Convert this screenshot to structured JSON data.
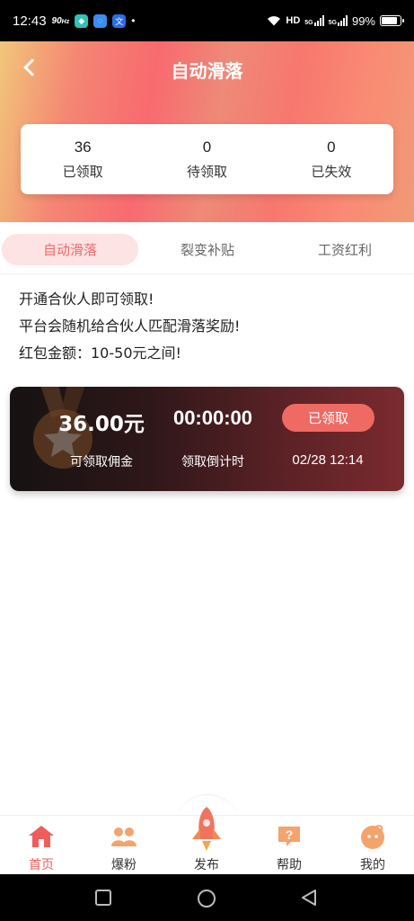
{
  "status_bar": {
    "time": "12:43",
    "refresh": "90",
    "refresh_unit": "Hz",
    "app_icons": [
      {
        "name": "app-icon-1",
        "color": "#2ec4b6"
      },
      {
        "name": "chat-icon",
        "color": "#3b8df0"
      },
      {
        "name": "translate-icon",
        "color": "#2b6de8"
      }
    ],
    "network": "HD",
    "sim1": "5G",
    "sim2": "5G",
    "battery": "99%"
  },
  "header": {
    "title": "自动滑落",
    "back_icon": "chevron-left-icon"
  },
  "stats": [
    {
      "value": "36",
      "label": "已领取"
    },
    {
      "value": "0",
      "label": "待领取"
    },
    {
      "value": "0",
      "label": "已失效"
    }
  ],
  "tabs": [
    {
      "label": "自动滑落",
      "active": true
    },
    {
      "label": "裂变补贴",
      "active": false
    },
    {
      "label": "工资红利",
      "active": false
    }
  ],
  "intro": {
    "line1": "开通合伙人即可领取!",
    "line2": "平台会随机给合伙人匹配滑落奖励!",
    "line3": "红包金额：10-50元之间!"
  },
  "reward": {
    "amount": "36.00元",
    "amount_label": "可领取佣金",
    "countdown": "00:00:00",
    "countdown_label": "领取倒计时",
    "button": "已领取",
    "date": "02/28 12:14",
    "accent": "#ee6a63"
  },
  "bottom_nav": [
    {
      "label": "首页",
      "icon": "home-icon",
      "active": true
    },
    {
      "label": "爆粉",
      "icon": "users-icon",
      "active": false
    },
    {
      "label": "发布",
      "icon": "rocket-icon",
      "active": false
    },
    {
      "label": "帮助",
      "icon": "help-icon",
      "active": false
    },
    {
      "label": "我的",
      "icon": "profile-icon",
      "active": false
    }
  ],
  "colors": {
    "primary": "#ef5d5b",
    "icon_orange": "#f4a36c",
    "tab_active_bg": "#fde3e4"
  }
}
